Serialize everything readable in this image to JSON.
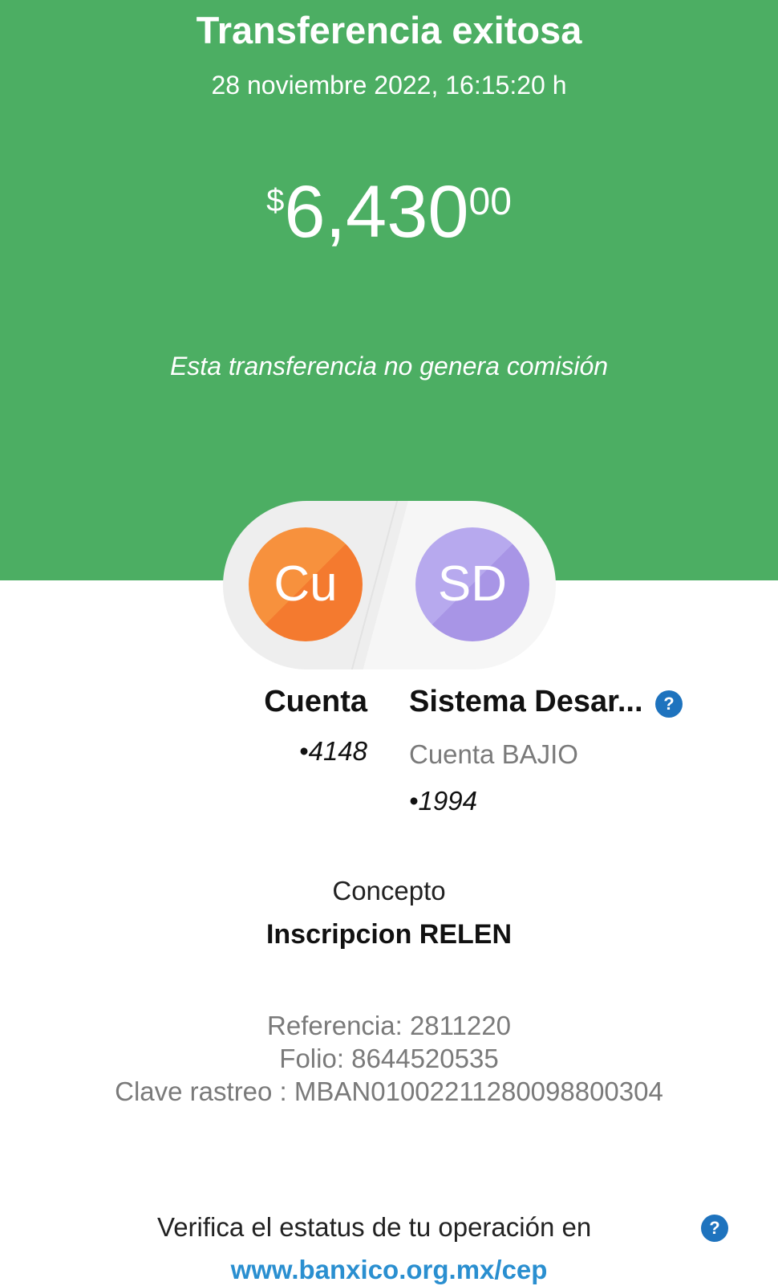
{
  "header": {
    "title": "Transferencia exitosa",
    "datetime": "28 noviembre 2022, 16:15:20 h"
  },
  "amount": {
    "currency": "$",
    "integer": "6,430",
    "cents": "00"
  },
  "fee_note": "Esta transferencia no genera comisión",
  "origin": {
    "initials": "Cu",
    "name": "Cuenta",
    "account": "•4148"
  },
  "destination": {
    "initials": "SD",
    "name": "Sistema Desar...",
    "bank": "Cuenta BAJIO",
    "account": "•1994",
    "help_icon": "?"
  },
  "concept": {
    "label": "Concepto",
    "value": "Inscripcion RELEN"
  },
  "references": {
    "referencia": "Referencia: 2811220",
    "folio": "Folio: 8644520535",
    "clave_rastreo": "Clave rastreo : MBAN01002211280098800304"
  },
  "verify": {
    "text": "Verifica el estatus de tu operación en",
    "link": "www.banxico.org.mx/cep",
    "help_icon": "?"
  },
  "colors": {
    "header_bg": "#4cae63",
    "origin_avatar": "#f47a2f",
    "destination_avatar": "#a895e6",
    "help_icon": "#1e73be",
    "link": "#2a8fd0"
  },
  "icons": {
    "origin_avatar": "avatar-initials",
    "destination_avatar": "avatar-initials",
    "help": "question-circle-icon"
  }
}
